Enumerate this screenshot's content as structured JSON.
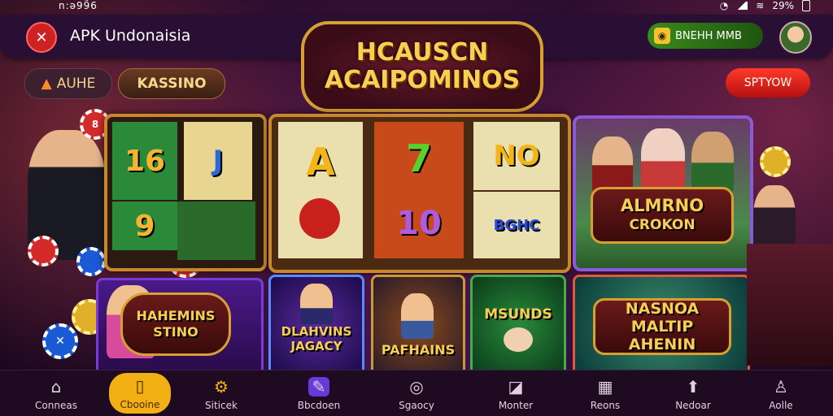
{
  "status_bar": {
    "time": "n:ə99̃6",
    "battery": "29%"
  },
  "header": {
    "title": "APK Undonaisia",
    "coin_pill": "BNEHH MMB"
  },
  "tabs": [
    {
      "label": "AUHE",
      "icon": "flame-icon"
    },
    {
      "label": "KASSINO"
    }
  ],
  "promo_button": "SPTYOW",
  "headline": {
    "line1": "HCAUSCN",
    "line2": "ACAIPOMINOS"
  },
  "reels_left": [
    "16",
    "9"
  ],
  "reels_center": [
    "A",
    "7",
    "NO",
    "10",
    "BGHC"
  ],
  "feature_banner": {
    "line1": "ALMRNO",
    "line2": "CROKON"
  },
  "left_banner": {
    "line1": "HAHEMINS",
    "line2": "STINO"
  },
  "cards": [
    {
      "label": "DLAHVINS JAGACY",
      "border": "#5a8aff"
    },
    {
      "label": "PAFHAINS",
      "border": "#c89a30"
    },
    {
      "label": "MSUNDS",
      "border": "#4aaa4a"
    },
    {
      "label": "NASNOA MALTIP AHENIN",
      "border": "#e05a3a"
    }
  ],
  "bottom_nav": [
    {
      "label": "Conneas",
      "icon": "home-icon"
    },
    {
      "label": "Cbooine",
      "icon": "document-icon",
      "active": true
    },
    {
      "label": "Siticek",
      "icon": "gear-icon"
    },
    {
      "label": "Bbcdoen",
      "icon": "edit-icon"
    },
    {
      "label": "Sgaocy",
      "icon": "slot-icon"
    },
    {
      "label": "Monter",
      "icon": "chart-icon"
    },
    {
      "label": "Reons",
      "icon": "grid-icon"
    },
    {
      "label": "Nedoar",
      "icon": "upload-icon"
    },
    {
      "label": "Aolle",
      "icon": "user-icon"
    }
  ],
  "colors": {
    "accent": "#f2b015",
    "gold": "#f7cf55",
    "promo_red": "#d11a1a"
  }
}
